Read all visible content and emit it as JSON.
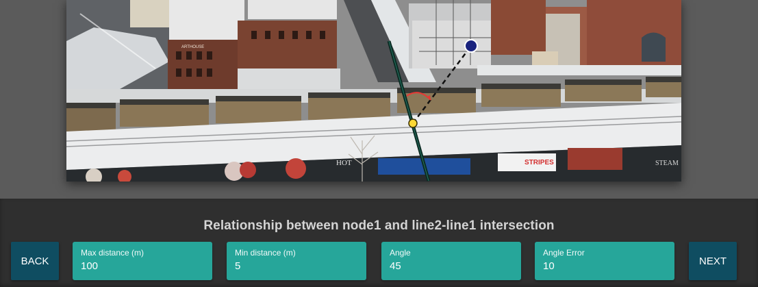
{
  "panel": {
    "title": "Relationship between node1 and line2-line1 intersection",
    "back_label": "BACK",
    "next_label": "NEXT",
    "fields": [
      {
        "label": "Max distance (m)",
        "value": "100"
      },
      {
        "label": "Min distance (m)",
        "value": "5"
      },
      {
        "label": "Angle",
        "value": "45"
      },
      {
        "label": "Angle Error",
        "value": "10"
      }
    ]
  },
  "photo": {
    "signs": {
      "stripes": "STRIPES",
      "steam": "STEAM",
      "hotel": "HOT",
      "building": "ARTHOUSE"
    }
  },
  "colors": {
    "panel_bg": "#2f2f2f",
    "nav_button": "#0f4d61",
    "field_bg": "#26a69a",
    "node_marker": "#1a237e",
    "intersection_marker": "#fdd835",
    "angle_arc": "#e53935",
    "line": "#0b2a22"
  }
}
